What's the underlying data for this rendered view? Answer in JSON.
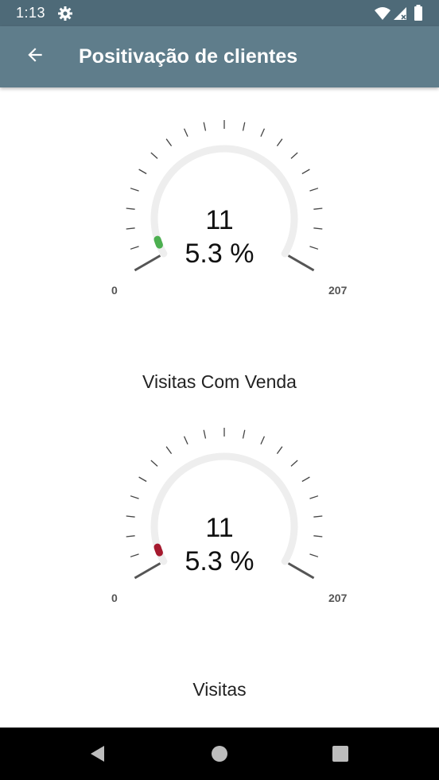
{
  "status_bar": {
    "time": "1:13",
    "icons": [
      "gear-icon",
      "wifi-icon",
      "signal-icon",
      "battery-icon"
    ]
  },
  "app_bar": {
    "title": "Positivação de clientes",
    "back_icon": "arrow-back-icon",
    "background": "#5f7d8b"
  },
  "gauges": [
    {
      "count": "11",
      "percent_text": "5.3 %",
      "min_label": "0",
      "max_label": "207",
      "label": "Visitas Com Venda",
      "fraction": 0.053,
      "indicator_color": "#4caf50"
    },
    {
      "count": "11",
      "percent_text": "5.3 %",
      "min_label": "0",
      "max_label": "207",
      "label": "Visitas",
      "fraction": 0.053,
      "indicator_color": "#a5192e"
    }
  ],
  "nav_bar": {
    "icons": [
      "nav-back-icon",
      "nav-home-icon",
      "nav-recent-icon"
    ]
  }
}
